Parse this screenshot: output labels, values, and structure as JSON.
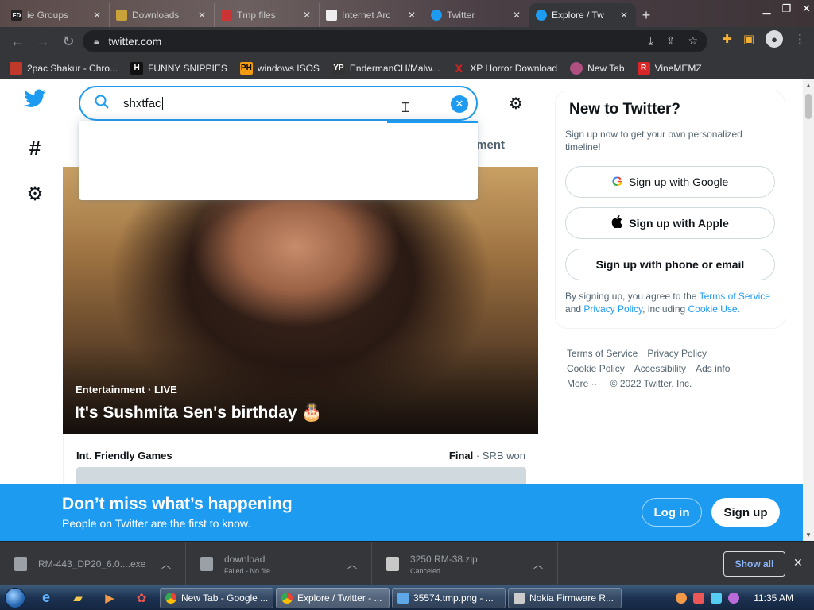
{
  "browser": {
    "tabs": [
      {
        "title": "ie Groups",
        "fav": "FD",
        "color": "#222"
      },
      {
        "title": "Downloads",
        "fav": "",
        "color": "#c9a23a"
      },
      {
        "title": "Tmp files",
        "fav": "",
        "color": "#c33"
      },
      {
        "title": "Internet Arc",
        "fav": "",
        "color": "#eee"
      },
      {
        "title": "Twitter",
        "fav": "",
        "color": "#1d9bf0"
      },
      {
        "title": "Explore / Tw",
        "fav": "",
        "color": "#1d9bf0",
        "active": true
      }
    ],
    "new_tab": "+",
    "url": "twitter.com",
    "bookmarks": [
      {
        "label": "2pac Shakur - Chro...",
        "icon": "",
        "color": "#c0392b"
      },
      {
        "label": "FUNNY SNIPPIES",
        "icon": "H",
        "color": "#111"
      },
      {
        "label": "windows ISOS",
        "icon": "PH",
        "color": "#f39c12"
      },
      {
        "label": "EndermanCH/Malw...",
        "icon": "YP",
        "color": "#333"
      },
      {
        "label": "XP Horror Download",
        "icon": "X",
        "color": "#e02020"
      },
      {
        "label": "New Tab",
        "icon": "",
        "color": "#b05080"
      },
      {
        "label": "VineMEMZ",
        "icon": "R",
        "color": "#d62828"
      }
    ]
  },
  "twitter": {
    "search_query": "shxtfac",
    "peek_tab": "nment",
    "hero": {
      "category": "Entertainment · LIVE",
      "title": "It's Sushmita Sen's birthday 🎂"
    },
    "games": {
      "title": "Int. Friendly Games",
      "status_bold": "Final",
      "status_rest": " · SRB won"
    },
    "new_box": {
      "title": "New to Twitter?",
      "subtitle": "Sign up now to get your own personalized timeline!",
      "google": "Sign up with Google",
      "apple": "Sign up with Apple",
      "phone": "Sign up with phone or email",
      "terms_pre": "By signing up, you agree to the ",
      "terms_tos": "Terms of Service",
      "terms_and": " and ",
      "terms_privacy": "Privacy Policy",
      "terms_including": ", including ",
      "terms_cookie": "Cookie Use",
      "terms_end": "."
    },
    "footer": [
      "Terms of Service",
      "Privacy Policy",
      "Cookie Policy",
      "Accessibility",
      "Ads info",
      "More ···",
      "© 2022 Twitter, Inc."
    ],
    "banner": {
      "title": "Don’t miss what’s happening",
      "subtitle": "People on Twitter are the first to know.",
      "login": "Log in",
      "signup": "Sign up"
    }
  },
  "downloads": {
    "items": [
      {
        "name": "RM-443_DP20_6.0....exe",
        "status": ""
      },
      {
        "name": "download",
        "status": "Failed - No file"
      },
      {
        "name": "3250 RM-38.zip",
        "status": "Canceled"
      }
    ],
    "show_all": "Show all",
    "close": "✕"
  },
  "taskbar": {
    "tasks": [
      {
        "label": "New Tab - Google ...",
        "color": "#e94235"
      },
      {
        "label": "Explore / Twitter - ...",
        "color": "#e94235",
        "active": true
      },
      {
        "label": "35574.tmp.png - ...",
        "color": "#5fa8e8"
      },
      {
        "label": "Nokia Firmware R...",
        "color": "#ccc"
      }
    ],
    "clock": "11:35 AM"
  },
  "colors": {
    "twitter_blue": "#1d9bf0",
    "chrome_dark": "#35363a"
  }
}
